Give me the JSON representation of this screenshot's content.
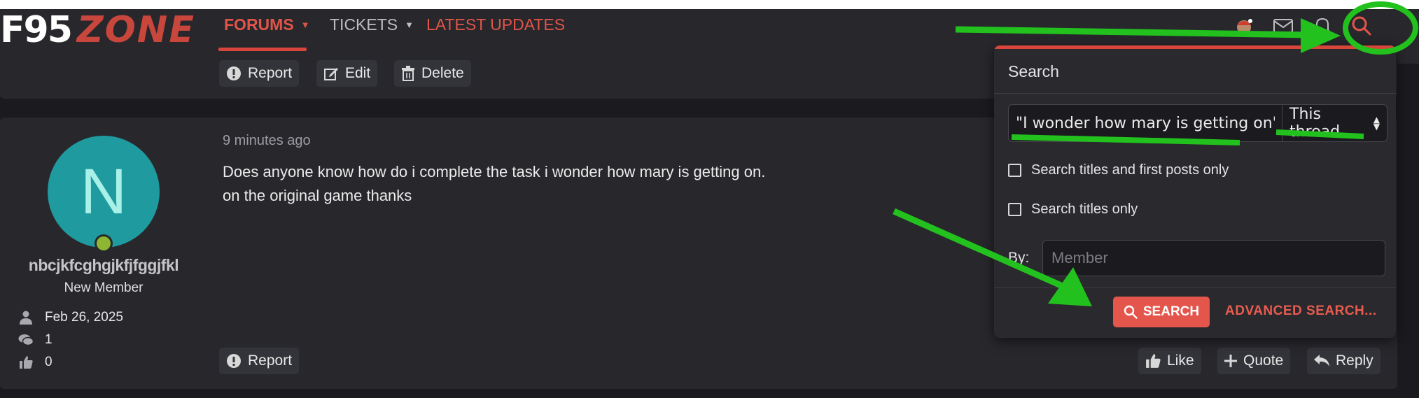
{
  "logo": {
    "part1": "F95",
    "part2": "ZONE"
  },
  "nav": {
    "tabs": [
      {
        "label": "FORUMS",
        "active": true
      },
      {
        "label": "TICKETS"
      },
      {
        "label": "LATEST UPDATES"
      }
    ]
  },
  "header_icons": [
    "avatar-icon",
    "mail-icon",
    "bell-icon",
    "search-icon"
  ],
  "prev_post": {
    "actions": [
      "Report",
      "Edit",
      "Delete"
    ]
  },
  "post": {
    "author": {
      "initial": "N",
      "username": "nbcjkfcghgjkfjfggjfkl",
      "title": "New Member",
      "joined": "Feb 26, 2025",
      "messages": "1",
      "reactions": "0"
    },
    "time": "9 minutes ago",
    "body_line1": "Does anyone know how do i complete the task i wonder how mary is getting on.",
    "body_line2": "on the original game thanks",
    "actions_left": [
      "Report"
    ],
    "actions_right": [
      "Like",
      "Quote",
      "Reply"
    ]
  },
  "search_panel": {
    "title": "Search",
    "query_value": "\"I wonder how mary is getting on\"",
    "scope": "This thread",
    "option1": "Search titles and first posts only",
    "option2": "Search titles only",
    "by_label": "By:",
    "member_placeholder": "Member",
    "search_button": "SEARCH",
    "advanced_link": "ADVANCED SEARCH..."
  },
  "colors": {
    "accent": "#e4554b",
    "annotation": "#22c11e"
  }
}
